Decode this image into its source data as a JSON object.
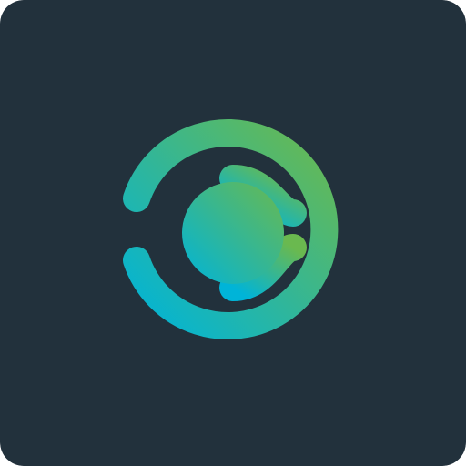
{
  "icon": {
    "name": "app-logo",
    "background_color": "#22313c",
    "gradient_start_color": "#00b4d8",
    "gradient_end_color": "#6ab94f"
  }
}
